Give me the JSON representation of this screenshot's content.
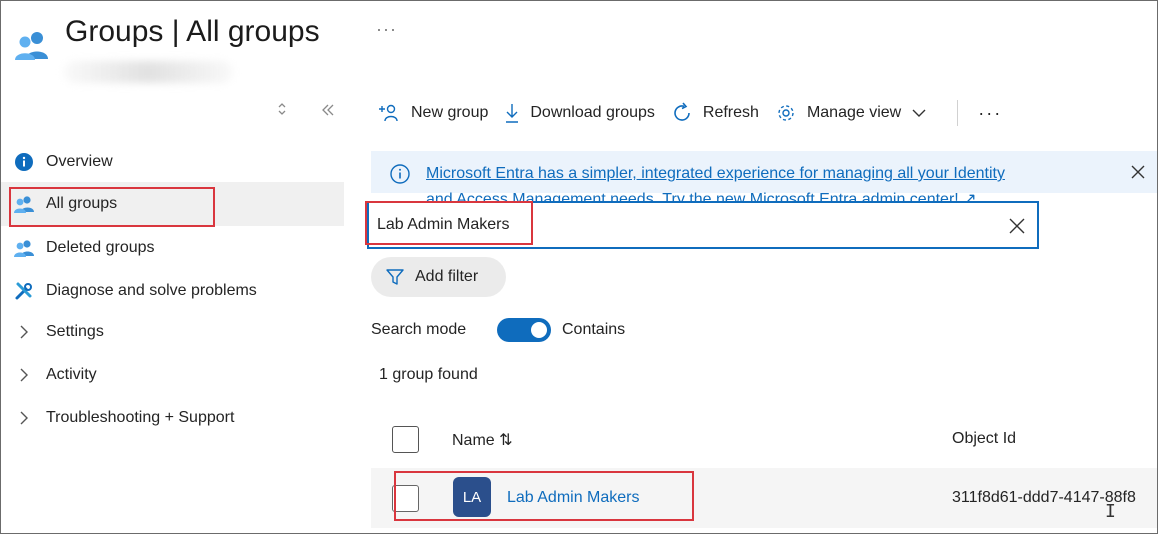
{
  "header": {
    "title": "Groups | All groups",
    "more": "···"
  },
  "sidebar": {
    "sort_icon": "updown-icon",
    "collapse_icon": "double-chevron-left-icon",
    "items": [
      {
        "label": "Overview",
        "icon": "info-icon"
      },
      {
        "label": "All groups",
        "icon": "groups-icon",
        "active": true
      },
      {
        "label": "Deleted groups",
        "icon": "groups-icon"
      },
      {
        "label": "Diagnose and solve problems",
        "icon": "wrench-icon"
      },
      {
        "label": "Settings",
        "icon": "chevron-right-icon"
      },
      {
        "label": "Activity",
        "icon": "chevron-right-icon"
      },
      {
        "label": "Troubleshooting + Support",
        "icon": "chevron-right-icon"
      }
    ]
  },
  "toolbar": {
    "new_group": "New group",
    "download_groups": "Download groups",
    "refresh": "Refresh",
    "manage_view": "Manage view",
    "more": "···"
  },
  "banner": {
    "line1": "Microsoft Entra has a simpler, integrated experience for managing all your Identity",
    "line2": "and Access Management needs. Try the new Microsoft Entra admin center! ↗"
  },
  "search": {
    "value": "Lab Admin Makers"
  },
  "filter": {
    "label": "Add filter"
  },
  "search_mode": {
    "label": "Search mode",
    "value": "Contains",
    "enabled": true
  },
  "results": {
    "count_text": "1 group found",
    "columns": [
      "Name ⇅",
      "Object Id"
    ],
    "rows": [
      {
        "initials": "LA",
        "name": "Lab Admin Makers",
        "object_id": "311f8d61-ddd7-4147-88f8"
      }
    ]
  },
  "colors": {
    "accent": "#0f6cbd",
    "highlight_box": "#d9363e",
    "avatar": "#2b4f8c",
    "banner_bg": "#ebf3fc"
  }
}
